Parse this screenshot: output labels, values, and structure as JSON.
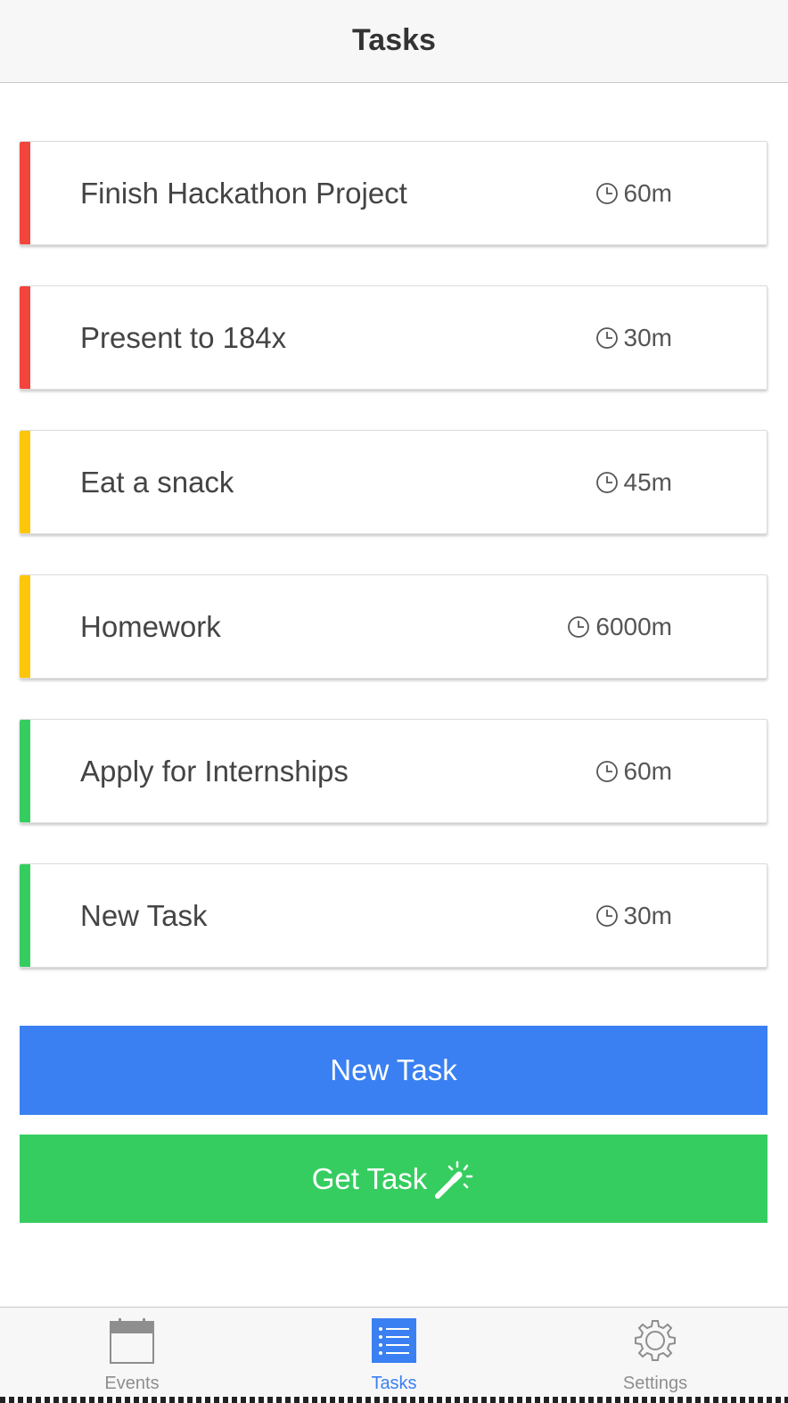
{
  "header": {
    "title": "Tasks"
  },
  "tasks": [
    {
      "name": "Finish Hackathon Project",
      "duration": "60m",
      "priority_color": "#f2453d"
    },
    {
      "name": "Present to 184x",
      "duration": "30m",
      "priority_color": "#f2453d"
    },
    {
      "name": "Eat a snack",
      "duration": "45m",
      "priority_color": "#fdc60b"
    },
    {
      "name": "Homework",
      "duration": "6000m",
      "priority_color": "#fdc60b"
    },
    {
      "name": "Apply for Internships",
      "duration": "60m",
      "priority_color": "#36cd60"
    },
    {
      "name": "New Task",
      "duration": "30m",
      "priority_color": "#36cd60"
    }
  ],
  "actions": {
    "new_task_label": "New Task",
    "get_task_label": "Get Task",
    "new_task_color": "#3a80f2",
    "get_task_color": "#36cd60"
  },
  "tabbar": {
    "events_label": "Events",
    "tasks_label": "Tasks",
    "settings_label": "Settings",
    "active_tab": "Tasks",
    "active_color": "#3a80f2"
  },
  "icons": {
    "duration": "clock-icon",
    "get_task": "magic-wand-icon",
    "events": "calendar-icon",
    "tasks": "list-icon",
    "settings": "gear-icon"
  }
}
